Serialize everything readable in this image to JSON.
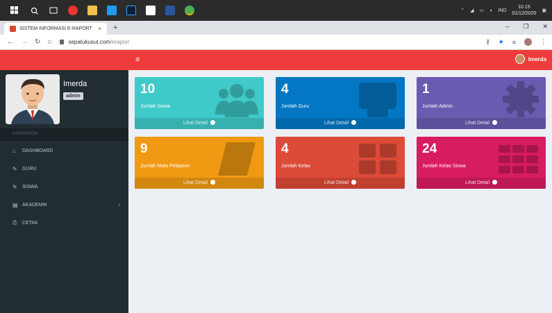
{
  "browser": {
    "tab_title": "SISTEM INFORMASI E-RAPORT",
    "tab_close": "×",
    "new_tab": "+",
    "url_host": "sepatukusut.com",
    "url_path": "/erapor/",
    "clock_time": "10.15",
    "clock_date": "01/12/2020",
    "lang": "IND"
  },
  "header": {
    "menu_toggle": "≡",
    "user": "Imerda"
  },
  "sidebar": {
    "user_name": "Imerda",
    "role": "admin",
    "nav_header": "NAVIGATION",
    "items": [
      {
        "label": "DASHBOARD",
        "icon": "home-icon"
      },
      {
        "label": "GURU",
        "icon": "edit-icon"
      },
      {
        "label": "SISWA",
        "icon": "edit-icon"
      },
      {
        "label": "AKADEMIK",
        "icon": "table-icon"
      },
      {
        "label": "CETAK",
        "icon": "print-icon"
      }
    ]
  },
  "boxes": [
    {
      "value": "10",
      "label": "Jumlah Siswa",
      "link": "Lihat Detail",
      "color": "#3fcac9",
      "icon": "users-icon"
    },
    {
      "value": "4",
      "label": "Jumlah Guru",
      "link": "Lihat Detail",
      "color": "#0377c4",
      "icon": "teacher-icon"
    },
    {
      "value": "1",
      "label": "Jumlah Admin",
      "link": "Lihat Detail",
      "color": "#6a5ab0",
      "icon": "gear-icon"
    },
    {
      "value": "9",
      "label": "Jumlah Mata Pelajaran",
      "link": "Lihat Detail",
      "color": "#f09a13",
      "icon": "book-icon"
    },
    {
      "value": "4",
      "label": "Jumlah Kelas",
      "link": "Lihat Detail",
      "color": "#dc4b38",
      "icon": "grid-icon"
    },
    {
      "value": "24",
      "label": "Jumlah Kelas Siswa",
      "link": "Lihat Detail",
      "color": "#d81c60",
      "icon": "grid-icon"
    }
  ],
  "colors": {
    "topbar": "#ef3b3b",
    "sidebar": "#222d32",
    "content_bg": "#ecf0f5"
  }
}
